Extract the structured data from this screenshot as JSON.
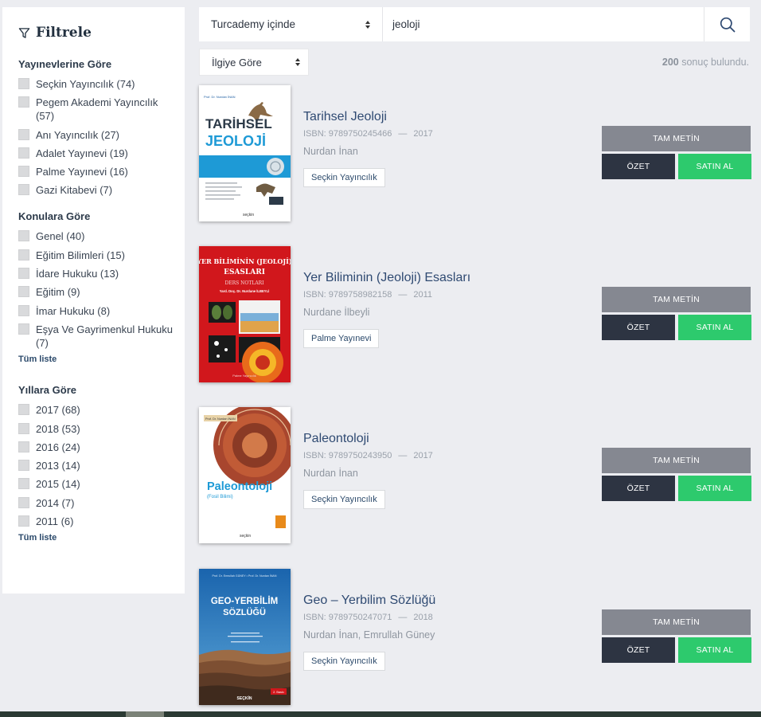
{
  "sidebar": {
    "title": "Filtrele",
    "facets": [
      {
        "title": "Yayınevlerine Göre",
        "items": [
          "Seçkin Yayıncılık (74)",
          "Pegem Akademi Yayıncılık (57)",
          "Anı Yayıncılık (27)",
          "Adalet Yayınevi (19)",
          "Palme Yayınevi (16)",
          "Gazi Kitabevi (7)"
        ]
      },
      {
        "title": "Konulara Göre",
        "items": [
          "Genel (40)",
          "Eğitim Bilimleri (15)",
          "İdare Hukuku (13)",
          "Eğitim (9)",
          "İmar Hukuku (8)",
          "Eşya Ve Gayrimenkul Hukuku (7)"
        ],
        "more": "Tüm liste"
      },
      {
        "title": "Yıllara Göre",
        "items": [
          "2017 (68)",
          "2018 (53)",
          "2016 (24)",
          "2013 (14)",
          "2015 (14)",
          "2014 (7)",
          "2011 (6)"
        ],
        "more": "Tüm liste"
      }
    ]
  },
  "search": {
    "scope": "Turcademy içinde",
    "query": "jeoloji"
  },
  "sort": {
    "selected": "İlgiye Göre"
  },
  "results_count": {
    "number": "200",
    "text": " sonuç bulundu."
  },
  "labels": {
    "full_text": "TAM METİN",
    "summary": "ÖZET",
    "buy": "SATIN AL"
  },
  "results": [
    {
      "title": "Tarihsel Jeoloji",
      "isbn": "ISBN: 9789750245466",
      "year": "2017",
      "authors": "Nurdan İnan",
      "publisher": "Seçkin Yayıncılık",
      "cover": {
        "line1": "TARİHSEL",
        "line2": "JEOLOJİ",
        "author": "Prof. Dr. Nurdan İNAN",
        "brand": "seçkin"
      }
    },
    {
      "title": "Yer Biliminin (Jeoloji) Esasları",
      "isbn": "ISBN: 9789758982158",
      "year": "2011",
      "authors": "Nurdane İlbeyli",
      "publisher": "Palme Yayınevi",
      "cover": {
        "line1": "YER BİLİMİNİN (JEOLOJİ)",
        "line2": "ESASLARI",
        "line3": "DERS NOTLARI",
        "author": "Yard. Doç. Dr. Nurdane İLBEYLİ",
        "brand": "Palme Yayıncılık"
      }
    },
    {
      "title": "Paleontoloji",
      "isbn": "ISBN: 9789750243950",
      "year": "2017",
      "authors": "Nurdan İnan",
      "publisher": "Seçkin Yayıncılık",
      "cover": {
        "author": "Prof. Dr. Nurdan İNAN",
        "line1": "Paleontoloji",
        "line2": "(Fosil Bilimi)",
        "brand": "seçkin"
      }
    },
    {
      "title": "Geo – Yerbilim Sözlüğü",
      "isbn": "ISBN: 9789750247071",
      "year": "2018",
      "authors": "Nurdan İnan, Emrullah Güney",
      "publisher": "Seçkin Yayıncılık",
      "cover": {
        "author": "Prof. Dr. Emrullah GÜNEY • Prof. Dr. Nurdan İNAN",
        "line1": "GEO-YERBİLİM",
        "line2": "SÖZLÜĞÜ",
        "brand": "SEÇKİN",
        "edition": "2. Baskı"
      }
    }
  ]
}
